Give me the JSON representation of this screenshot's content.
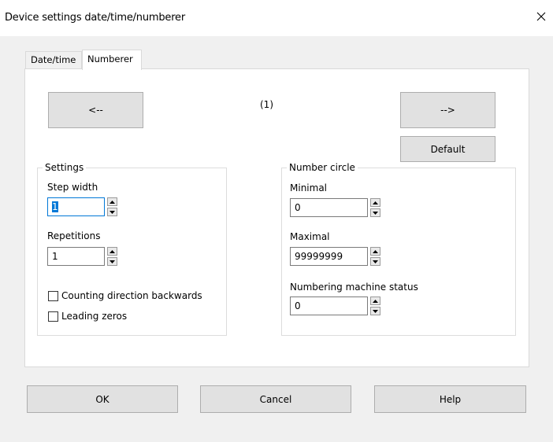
{
  "window": {
    "title": "Device settings date/time/numberer",
    "close_icon": "close-icon"
  },
  "tabs": [
    {
      "label": "Date/time",
      "active": false
    },
    {
      "label": "Numberer",
      "active": true
    }
  ],
  "navigator": {
    "prev_label": "<--",
    "next_label": "-->",
    "counter": "(1)",
    "default_label": "Default"
  },
  "settings": {
    "title": "Settings",
    "step_width": {
      "label": "Step width",
      "value": "1"
    },
    "repetitions": {
      "label": "Repetitions",
      "value": "1"
    },
    "counting_backwards": {
      "label": "Counting direction backwards",
      "checked": false
    },
    "leading_zeros": {
      "label": "Leading zeros",
      "checked": false
    }
  },
  "number_circle": {
    "title": "Number circle",
    "minimal": {
      "label": "Minimal",
      "value": "0"
    },
    "maximal": {
      "label": "Maximal",
      "value": "99999999"
    },
    "status": {
      "label": "Numbering machine status",
      "value": "0"
    }
  },
  "footer": {
    "ok_label": "OK",
    "cancel_label": "Cancel",
    "help_label": "Help"
  },
  "colors": {
    "window_bg": "#f0f0f0",
    "button_bg": "#e1e1e1",
    "focus": "#0078d7"
  }
}
